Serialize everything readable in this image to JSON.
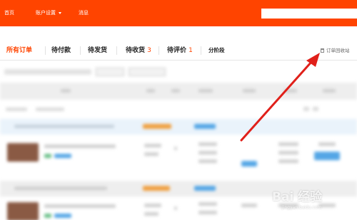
{
  "topbar": {
    "home": "首页",
    "account_settings": "账户设置",
    "messages": "消息",
    "search_placeholder": ""
  },
  "tabs": [
    {
      "label": "所有订单",
      "count": ""
    },
    {
      "label": "待付款",
      "count": ""
    },
    {
      "label": "待发货",
      "count": ""
    },
    {
      "label": "待收货",
      "count": "3"
    },
    {
      "label": "待评价",
      "count": "1"
    },
    {
      "label": "分阶段",
      "count": ""
    }
  ],
  "recycle_bin": {
    "label": "订单回收站",
    "icon": "trash-icon"
  },
  "watermark": {
    "brand": "Bai 经验",
    "url": "jingyan.baidu.com"
  },
  "colors": {
    "brand": "#ff4400",
    "arrow": "#e0201a"
  }
}
